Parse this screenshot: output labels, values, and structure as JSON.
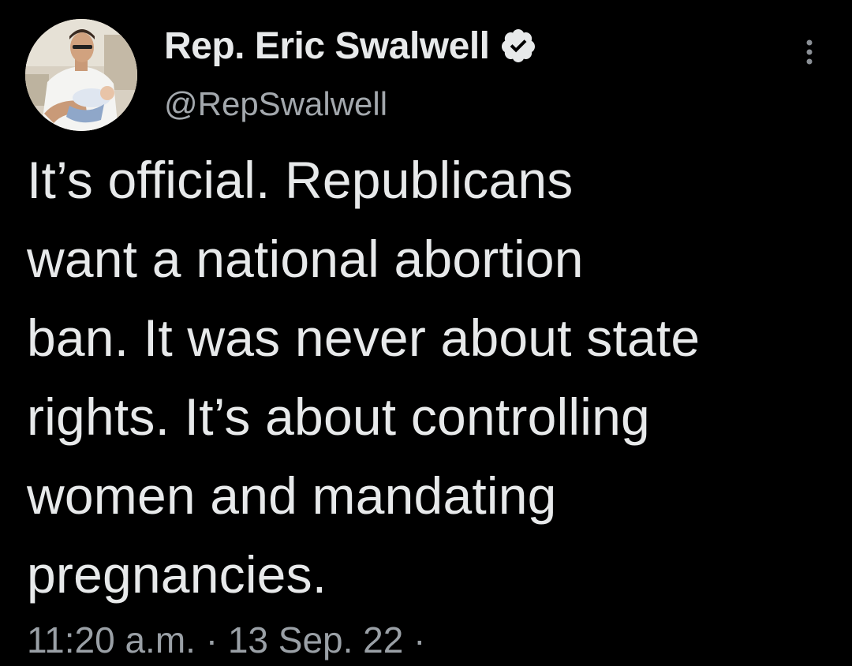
{
  "tweet": {
    "author": {
      "display_name": "Rep. Eric Swalwell",
      "handle": "@RepSwalwell",
      "verified": true,
      "avatar_icon": "profile-photo"
    },
    "text": "It’s official. Republicans\nwant a national abortion\nban. It was never about state\nrights. It’s about controlling\nwomen and mandating\npregnancies.",
    "timestamp": "11:20 a.m. · 13 Sep. 22 ·",
    "more_icon": "more-options-icon"
  },
  "colors": {
    "background": "#000000",
    "primary_text": "#e7e9ea",
    "secondary_text": "#9aa0a6",
    "verified_badge": "#e7e9ea"
  }
}
